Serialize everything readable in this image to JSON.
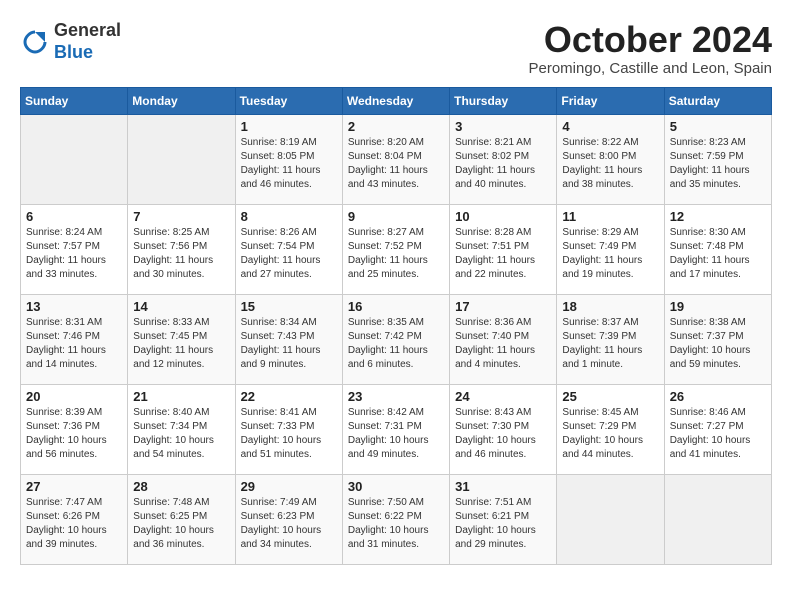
{
  "header": {
    "logo": {
      "general": "General",
      "blue": "Blue"
    },
    "title": "October 2024",
    "location": "Peromingo, Castille and Leon, Spain"
  },
  "weekdays": [
    "Sunday",
    "Monday",
    "Tuesday",
    "Wednesday",
    "Thursday",
    "Friday",
    "Saturday"
  ],
  "weeks": [
    [
      {
        "day": null,
        "sunrise": null,
        "sunset": null,
        "daylight": null
      },
      {
        "day": null,
        "sunrise": null,
        "sunset": null,
        "daylight": null
      },
      {
        "day": "1",
        "sunrise": "Sunrise: 8:19 AM",
        "sunset": "Sunset: 8:05 PM",
        "daylight": "Daylight: 11 hours and 46 minutes."
      },
      {
        "day": "2",
        "sunrise": "Sunrise: 8:20 AM",
        "sunset": "Sunset: 8:04 PM",
        "daylight": "Daylight: 11 hours and 43 minutes."
      },
      {
        "day": "3",
        "sunrise": "Sunrise: 8:21 AM",
        "sunset": "Sunset: 8:02 PM",
        "daylight": "Daylight: 11 hours and 40 minutes."
      },
      {
        "day": "4",
        "sunrise": "Sunrise: 8:22 AM",
        "sunset": "Sunset: 8:00 PM",
        "daylight": "Daylight: 11 hours and 38 minutes."
      },
      {
        "day": "5",
        "sunrise": "Sunrise: 8:23 AM",
        "sunset": "Sunset: 7:59 PM",
        "daylight": "Daylight: 11 hours and 35 minutes."
      }
    ],
    [
      {
        "day": "6",
        "sunrise": "Sunrise: 8:24 AM",
        "sunset": "Sunset: 7:57 PM",
        "daylight": "Daylight: 11 hours and 33 minutes."
      },
      {
        "day": "7",
        "sunrise": "Sunrise: 8:25 AM",
        "sunset": "Sunset: 7:56 PM",
        "daylight": "Daylight: 11 hours and 30 minutes."
      },
      {
        "day": "8",
        "sunrise": "Sunrise: 8:26 AM",
        "sunset": "Sunset: 7:54 PM",
        "daylight": "Daylight: 11 hours and 27 minutes."
      },
      {
        "day": "9",
        "sunrise": "Sunrise: 8:27 AM",
        "sunset": "Sunset: 7:52 PM",
        "daylight": "Daylight: 11 hours and 25 minutes."
      },
      {
        "day": "10",
        "sunrise": "Sunrise: 8:28 AM",
        "sunset": "Sunset: 7:51 PM",
        "daylight": "Daylight: 11 hours and 22 minutes."
      },
      {
        "day": "11",
        "sunrise": "Sunrise: 8:29 AM",
        "sunset": "Sunset: 7:49 PM",
        "daylight": "Daylight: 11 hours and 19 minutes."
      },
      {
        "day": "12",
        "sunrise": "Sunrise: 8:30 AM",
        "sunset": "Sunset: 7:48 PM",
        "daylight": "Daylight: 11 hours and 17 minutes."
      }
    ],
    [
      {
        "day": "13",
        "sunrise": "Sunrise: 8:31 AM",
        "sunset": "Sunset: 7:46 PM",
        "daylight": "Daylight: 11 hours and 14 minutes."
      },
      {
        "day": "14",
        "sunrise": "Sunrise: 8:33 AM",
        "sunset": "Sunset: 7:45 PM",
        "daylight": "Daylight: 11 hours and 12 minutes."
      },
      {
        "day": "15",
        "sunrise": "Sunrise: 8:34 AM",
        "sunset": "Sunset: 7:43 PM",
        "daylight": "Daylight: 11 hours and 9 minutes."
      },
      {
        "day": "16",
        "sunrise": "Sunrise: 8:35 AM",
        "sunset": "Sunset: 7:42 PM",
        "daylight": "Daylight: 11 hours and 6 minutes."
      },
      {
        "day": "17",
        "sunrise": "Sunrise: 8:36 AM",
        "sunset": "Sunset: 7:40 PM",
        "daylight": "Daylight: 11 hours and 4 minutes."
      },
      {
        "day": "18",
        "sunrise": "Sunrise: 8:37 AM",
        "sunset": "Sunset: 7:39 PM",
        "daylight": "Daylight: 11 hours and 1 minute."
      },
      {
        "day": "19",
        "sunrise": "Sunrise: 8:38 AM",
        "sunset": "Sunset: 7:37 PM",
        "daylight": "Daylight: 10 hours and 59 minutes."
      }
    ],
    [
      {
        "day": "20",
        "sunrise": "Sunrise: 8:39 AM",
        "sunset": "Sunset: 7:36 PM",
        "daylight": "Daylight: 10 hours and 56 minutes."
      },
      {
        "day": "21",
        "sunrise": "Sunrise: 8:40 AM",
        "sunset": "Sunset: 7:34 PM",
        "daylight": "Daylight: 10 hours and 54 minutes."
      },
      {
        "day": "22",
        "sunrise": "Sunrise: 8:41 AM",
        "sunset": "Sunset: 7:33 PM",
        "daylight": "Daylight: 10 hours and 51 minutes."
      },
      {
        "day": "23",
        "sunrise": "Sunrise: 8:42 AM",
        "sunset": "Sunset: 7:31 PM",
        "daylight": "Daylight: 10 hours and 49 minutes."
      },
      {
        "day": "24",
        "sunrise": "Sunrise: 8:43 AM",
        "sunset": "Sunset: 7:30 PM",
        "daylight": "Daylight: 10 hours and 46 minutes."
      },
      {
        "day": "25",
        "sunrise": "Sunrise: 8:45 AM",
        "sunset": "Sunset: 7:29 PM",
        "daylight": "Daylight: 10 hours and 44 minutes."
      },
      {
        "day": "26",
        "sunrise": "Sunrise: 8:46 AM",
        "sunset": "Sunset: 7:27 PM",
        "daylight": "Daylight: 10 hours and 41 minutes."
      }
    ],
    [
      {
        "day": "27",
        "sunrise": "Sunrise: 7:47 AM",
        "sunset": "Sunset: 6:26 PM",
        "daylight": "Daylight: 10 hours and 39 minutes."
      },
      {
        "day": "28",
        "sunrise": "Sunrise: 7:48 AM",
        "sunset": "Sunset: 6:25 PM",
        "daylight": "Daylight: 10 hours and 36 minutes."
      },
      {
        "day": "29",
        "sunrise": "Sunrise: 7:49 AM",
        "sunset": "Sunset: 6:23 PM",
        "daylight": "Daylight: 10 hours and 34 minutes."
      },
      {
        "day": "30",
        "sunrise": "Sunrise: 7:50 AM",
        "sunset": "Sunset: 6:22 PM",
        "daylight": "Daylight: 10 hours and 31 minutes."
      },
      {
        "day": "31",
        "sunrise": "Sunrise: 7:51 AM",
        "sunset": "Sunset: 6:21 PM",
        "daylight": "Daylight: 10 hours and 29 minutes."
      },
      {
        "day": null,
        "sunrise": null,
        "sunset": null,
        "daylight": null
      },
      {
        "day": null,
        "sunrise": null,
        "sunset": null,
        "daylight": null
      }
    ]
  ]
}
